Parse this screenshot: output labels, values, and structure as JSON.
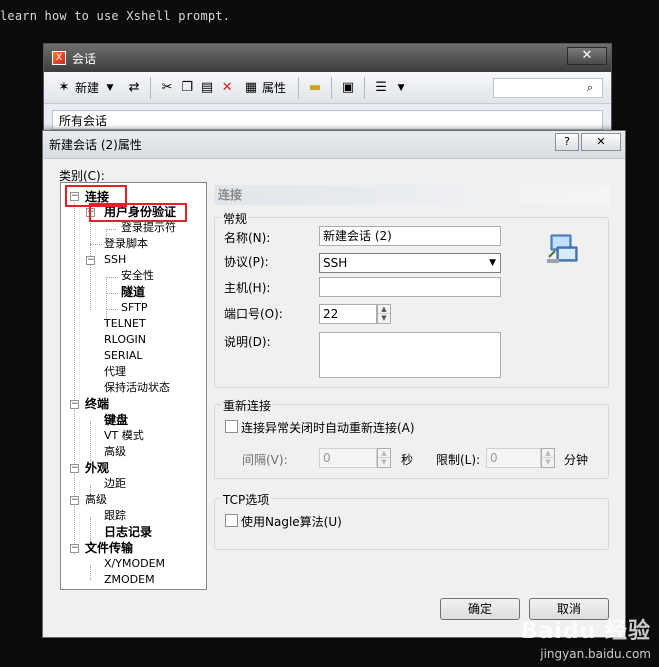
{
  "terminal": {
    "line": "learn how to use Xshell prompt."
  },
  "session_window": {
    "title": "会话",
    "close_glyph": "✕",
    "toolbar": {
      "new_label": "新建",
      "properties_label": "属性"
    },
    "address": "所有会话"
  },
  "dialog": {
    "title": "新建会话 (2)属性",
    "help_glyph": "?",
    "close_glyph": "✕",
    "category_label": "类别(C):",
    "tree": [
      {
        "label": "连接",
        "bold": true
      },
      {
        "label": "用户身份验证",
        "bold": true
      },
      {
        "label": "登录提示符",
        "bold": false
      },
      {
        "label": "登录脚本",
        "bold": false
      },
      {
        "label": "SSH",
        "bold": false
      },
      {
        "label": "安全性",
        "bold": false
      },
      {
        "label": "隧道",
        "bold": true
      },
      {
        "label": "SFTP",
        "bold": false
      },
      {
        "label": "TELNET",
        "bold": false
      },
      {
        "label": "RLOGIN",
        "bold": false
      },
      {
        "label": "SERIAL",
        "bold": false
      },
      {
        "label": "代理",
        "bold": false
      },
      {
        "label": "保持活动状态",
        "bold": false
      },
      {
        "label": "终端",
        "bold": true
      },
      {
        "label": "键盘",
        "bold": true
      },
      {
        "label": "VT 模式",
        "bold": false
      },
      {
        "label": "高级",
        "bold": false
      },
      {
        "label": "外观",
        "bold": true
      },
      {
        "label": "边距",
        "bold": false
      },
      {
        "label": "高级",
        "bold": false
      },
      {
        "label": "跟踪",
        "bold": false
      },
      {
        "label": "日志记录",
        "bold": true
      },
      {
        "label": "文件传输",
        "bold": true
      },
      {
        "label": "X/YMODEM",
        "bold": false
      },
      {
        "label": "ZMODEM",
        "bold": false
      }
    ],
    "section_header": "连接",
    "general": {
      "title": "常规",
      "name_label": "名称(N):",
      "name_value": "新建会话 (2)",
      "protocol_label": "协议(P):",
      "protocol_value": "SSH",
      "host_label": "主机(H):",
      "host_value": "",
      "port_label": "端口号(O):",
      "port_value": "22",
      "desc_label": "说明(D):"
    },
    "reconnect": {
      "title": "重新连接",
      "auto_label": "连接异常关闭时自动重新连接(A)",
      "interval_label": "间隔(V):",
      "interval_value": "0",
      "seconds_label": "秒",
      "limit_label": "限制(L):",
      "limit_value": "0",
      "minutes_label": "分钟"
    },
    "tcp": {
      "title": "TCP选项",
      "nagle_label": "使用Nagle算法(U)"
    },
    "ok_label": "确定",
    "cancel_label": "取消"
  },
  "watermark": {
    "brand": "Baidu 经验",
    "url": "jingyan.baidu.com"
  },
  "colors": {
    "highlight": "#e4212b",
    "dialog_bg": "#f0f0f0"
  }
}
